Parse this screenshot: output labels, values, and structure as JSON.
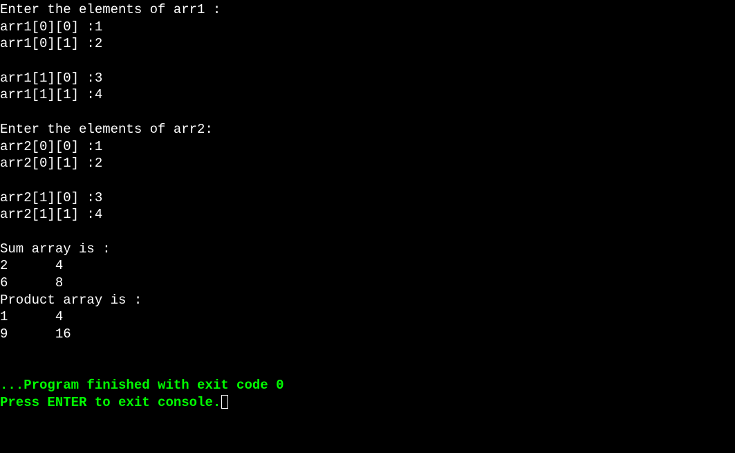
{
  "terminal": {
    "lines": [
      {
        "text": "Enter the elements of arr1 :",
        "class": ""
      },
      {
        "text": "arr1[0][0] :1",
        "class": ""
      },
      {
        "text": "arr1[0][1] :2",
        "class": ""
      },
      {
        "text": "",
        "class": ""
      },
      {
        "text": "arr1[1][0] :3",
        "class": ""
      },
      {
        "text": "arr1[1][1] :4",
        "class": ""
      },
      {
        "text": "",
        "class": ""
      },
      {
        "text": "Enter the elements of arr2:",
        "class": ""
      },
      {
        "text": "arr2[0][0] :1",
        "class": ""
      },
      {
        "text": "arr2[0][1] :2",
        "class": ""
      },
      {
        "text": "",
        "class": ""
      },
      {
        "text": "arr2[1][0] :3",
        "class": ""
      },
      {
        "text": "arr2[1][1] :4",
        "class": ""
      },
      {
        "text": "",
        "class": ""
      },
      {
        "text": "Sum array is :",
        "class": ""
      },
      {
        "text": "2      4",
        "class": ""
      },
      {
        "text": "6      8",
        "class": ""
      },
      {
        "text": "Product array is :",
        "class": ""
      },
      {
        "text": "1      4",
        "class": ""
      },
      {
        "text": "9      16",
        "class": ""
      },
      {
        "text": "",
        "class": ""
      },
      {
        "text": "",
        "class": ""
      },
      {
        "text": "...Program finished with exit code 0",
        "class": "green"
      },
      {
        "text": "Press ENTER to exit console.",
        "class": "green",
        "cursor": true
      }
    ]
  },
  "program_data": {
    "arr1_prompt": "Enter the elements of arr1 :",
    "arr2_prompt": "Enter the elements of arr2:",
    "arr1": [
      [
        1,
        2
      ],
      [
        3,
        4
      ]
    ],
    "arr2": [
      [
        1,
        2
      ],
      [
        3,
        4
      ]
    ],
    "sum_label": "Sum array is :",
    "sum_array": [
      [
        2,
        4
      ],
      [
        6,
        8
      ]
    ],
    "product_label": "Product array is :",
    "product_array": [
      [
        1,
        4
      ],
      [
        9,
        16
      ]
    ],
    "exit_message": "...Program finished with exit code 0",
    "enter_prompt": "Press ENTER to exit console."
  }
}
